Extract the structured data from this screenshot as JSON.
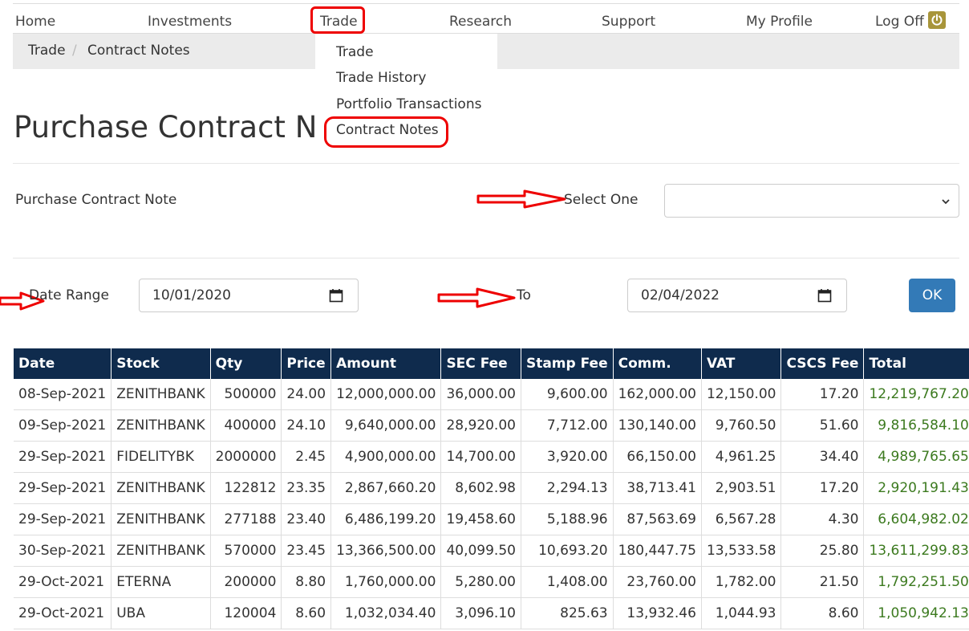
{
  "nav": {
    "items": [
      "Home",
      "Investments",
      "Trade",
      "Research",
      "Support",
      "My Profile",
      "Log Off"
    ],
    "logoff_icon": "power-icon"
  },
  "breadcrumb": {
    "items": [
      "Trade",
      "/",
      "Contract Notes"
    ]
  },
  "dropdown": {
    "items": [
      "Trade",
      "Trade History",
      "Portfolio Transactions",
      "Contract Notes"
    ]
  },
  "page": {
    "title": "Purchase Contract Nc"
  },
  "form": {
    "contract_label": "Purchase Contract Note",
    "select_label": "Select One",
    "select_value": "",
    "date_range_label": "Date Range",
    "date_from": "10/01/2020",
    "to_label": "To",
    "date_to": "02/04/2022",
    "ok_label": "OK"
  },
  "table": {
    "headers": [
      "Date",
      "Stock",
      "Qty",
      "Price",
      "Amount",
      "SEC Fee",
      "Stamp Fee",
      "Comm.",
      "VAT",
      "CSCS Fee",
      "Total"
    ],
    "rows": [
      [
        "08-Sep-2021",
        "ZENITHBANK",
        "500000",
        "24.00",
        "12,000,000.00",
        "36,000.00",
        "9,600.00",
        "162,000.00",
        "12,150.00",
        "17.20",
        "12,219,767.20"
      ],
      [
        "09-Sep-2021",
        "ZENITHBANK",
        "400000",
        "24.10",
        "9,640,000.00",
        "28,920.00",
        "7,712.00",
        "130,140.00",
        "9,760.50",
        "51.60",
        "9,816,584.10"
      ],
      [
        "29-Sep-2021",
        "FIDELITYBK",
        "2000000",
        "2.45",
        "4,900,000.00",
        "14,700.00",
        "3,920.00",
        "66,150.00",
        "4,961.25",
        "34.40",
        "4,989,765.65"
      ],
      [
        "29-Sep-2021",
        "ZENITHBANK",
        "122812",
        "23.35",
        "2,867,660.20",
        "8,602.98",
        "2,294.13",
        "38,713.41",
        "2,903.51",
        "17.20",
        "2,920,191.43"
      ],
      [
        "29-Sep-2021",
        "ZENITHBANK",
        "277188",
        "23.40",
        "6,486,199.20",
        "19,458.60",
        "5,188.96",
        "87,563.69",
        "6,567.28",
        "4.30",
        "6,604,982.02"
      ],
      [
        "30-Sep-2021",
        "ZENITHBANK",
        "570000",
        "23.45",
        "13,366,500.00",
        "40,099.50",
        "10,693.20",
        "180,447.75",
        "13,533.58",
        "25.80",
        "13,611,299.83"
      ],
      [
        "29-Oct-2021",
        "ETERNA",
        "200000",
        "8.80",
        "1,760,000.00",
        "5,280.00",
        "1,408.00",
        "23,760.00",
        "1,782.00",
        "21.50",
        "1,792,251.50"
      ],
      [
        "29-Oct-2021",
        "UBA",
        "120004",
        "8.60",
        "1,032,034.40",
        "3,096.10",
        "825.63",
        "13,932.46",
        "1,044.93",
        "8.60",
        "1,050,942.13"
      ]
    ]
  },
  "colors": {
    "header_bg": "#0f2b4d",
    "total_text": "#3c7a1f",
    "ok_button": "#337ab7",
    "annotation_red": "#e00000"
  }
}
